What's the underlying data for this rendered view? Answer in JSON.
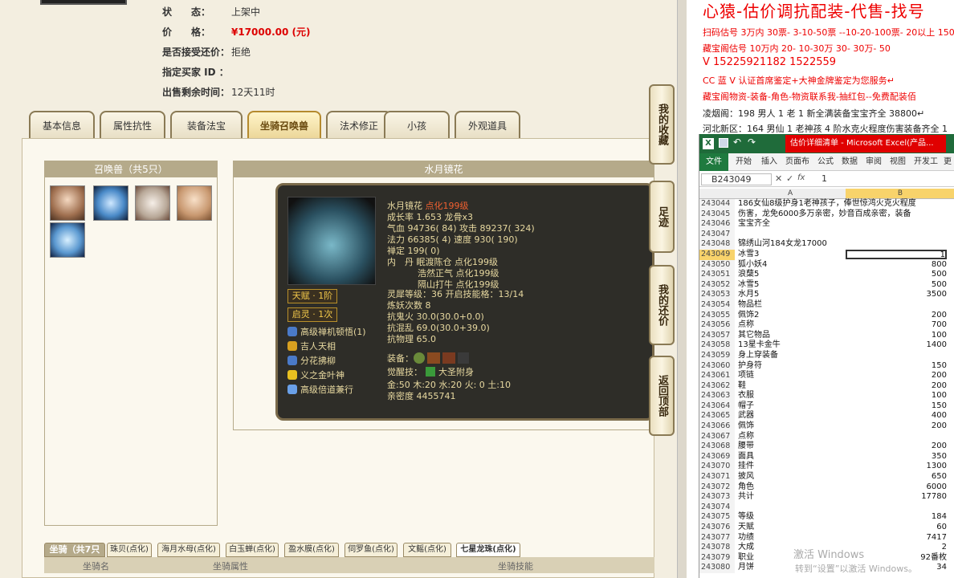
{
  "listing": {
    "status_label": "状　　态：",
    "status_value": "上架中",
    "price_label": "价　　格：",
    "price_value": "¥17000.00 (元)",
    "counter_label": "是否接受还价：",
    "counter_value": "拒绝",
    "buyer_label": "指定买家 ID ：",
    "buyer_value": "",
    "time_label": "出售剩余时间：",
    "time_value": "12天11时"
  },
  "tabs": [
    "基本信息",
    "属性抗性",
    "装备法宝",
    "坐骑召唤兽",
    "法术修正",
    "小孩",
    "外观道具"
  ],
  "active_tab": 3,
  "summon": {
    "header": "召唤兽（共5只）",
    "pets": [
      "pet-1",
      "pet-2",
      "pet-3",
      "pet-4",
      "pet-5"
    ]
  },
  "detail": {
    "header": "水月镜花",
    "name": "水月镜花",
    "name_tag": "点化199级",
    "growth": "成长率 1.653 龙骨x3",
    "hp": "气血 94736( 84) 攻击 89237( 324)",
    "mp": "法力 66385( 4) 速度 930( 190)",
    "zen": "禅定 199( 0)",
    "neidan_1": "内　丹 眠渡陈仓 点化199级",
    "neidan_2": "浩然正气 点化199级",
    "neidan_3": "隔山打牛 点化199级",
    "spirit": "灵犀等级：36 开启技能格：13/14",
    "refine": "炼妖次数 8",
    "resist_1": "抗鬼火 30.0(30.0+0.0)",
    "resist_2": "抗混乱 69.0(30.0+39.0)",
    "resist_3": "抗物理 65.0",
    "equip_label": "装备：",
    "awaken_label": "觉醒技：",
    "awaken_value": "大圣附身",
    "elements": "金:50 木:20 水:20 火: 0 土:10",
    "intimacy": "亲密度 4455741",
    "badge_1": "天赋 · 1阶",
    "badge_2": "启灵 · 1次",
    "skills": [
      "高级禅机顿悟(1)",
      "吉人天相",
      "分花拂柳",
      "义之金叶神",
      "高级倍道兼行"
    ]
  },
  "side_buttons": [
    "我的收藏",
    "足迹",
    "我的还价",
    "返回顶部"
  ],
  "mount": {
    "label": "坐骑（共7只",
    "tabs": [
      "珠贝(点化)",
      "海月水母(点化)",
      "白玉蝉(点化)",
      "盈水膜(点化)",
      "伺罗鱼(点化)",
      "文鳐(点化)",
      "七星龙珠(点化)"
    ],
    "headers": [
      "坐骑名",
      "坐骑属性",
      "坐骑技能"
    ]
  },
  "ads": {
    "title": "心猿-估价调抗配装-代售-找号",
    "line1": "扫码估号 3万内 30票- 3-10-50票 --10-20-100票- 20以上 150+",
    "line2": "藏宝阁估号 10万内 20- 10-30万 30- 30万- 50",
    "phone": "V 15225921182  1522559",
    "line3": "CC 蓝 V 认证首席鉴定+大神金牌鉴定为您服务↵",
    "line4": "藏宝阁物资-装备-角色-物资联系我-抽红包--免费配装佰",
    "line5": "凌烟阁：198 男人 1 老 1 新全满装备宝宝齐全 38800↵",
    "line6": "河北新区：164 男仙 1 老神孩 4 阶水克火程度伤害装备齐全 1"
  },
  "excel": {
    "title": "估价详细清单 - Microsoft Excel(产品...",
    "ribbon": [
      "文件",
      "开始",
      "插入",
      "页面布",
      "公式",
      "数据",
      "审阅",
      "视图",
      "开发工",
      "更"
    ],
    "cell_ref": "B243049",
    "formula": "1",
    "col_a": "A",
    "col_b": "B",
    "rows": [
      {
        "n": "243044",
        "a": "186女仙8级护身1老神孩子，俸世惊鸿火克火程度",
        "b": ""
      },
      {
        "n": "243045",
        "a": "伤害，龙免6000多万亲密，妙音百成亲密，装备",
        "b": ""
      },
      {
        "n": "243046",
        "a": "宝宝齐全",
        "b": ""
      },
      {
        "n": "243047",
        "a": "",
        "b": ""
      },
      {
        "n": "243048",
        "a": "锦绣山河184女龙17000",
        "b": ""
      },
      {
        "n": "243049",
        "a": "冰雪3",
        "b": "1"
      },
      {
        "n": "243050",
        "a": "狐小妖4",
        "b": "800"
      },
      {
        "n": "243051",
        "a": "浪蘖5",
        "b": "500"
      },
      {
        "n": "243052",
        "a": "冰雪5",
        "b": "500"
      },
      {
        "n": "243053",
        "a": "水月5",
        "b": "3500"
      },
      {
        "n": "243054",
        "a": "物品栏",
        "b": ""
      },
      {
        "n": "243055",
        "a": "佩饰2",
        "b": "200"
      },
      {
        "n": "243056",
        "a": "点称",
        "b": "700"
      },
      {
        "n": "243057",
        "a": "其它物品",
        "b": "100"
      },
      {
        "n": "243058",
        "a": "13星卡金牛",
        "b": "1400"
      },
      {
        "n": "243059",
        "a": "身上穿装备",
        "b": ""
      },
      {
        "n": "243060",
        "a": "护身符",
        "b": "150"
      },
      {
        "n": "243061",
        "a": "项链",
        "b": "200"
      },
      {
        "n": "243062",
        "a": "鞋",
        "b": "200"
      },
      {
        "n": "243063",
        "a": "衣服",
        "b": "100"
      },
      {
        "n": "243064",
        "a": "帽子",
        "b": "150"
      },
      {
        "n": "243065",
        "a": "武器",
        "b": "400"
      },
      {
        "n": "243066",
        "a": "佩饰",
        "b": "200"
      },
      {
        "n": "243067",
        "a": "点称",
        "b": ""
      },
      {
        "n": "243068",
        "a": "腰带",
        "b": "200"
      },
      {
        "n": "243069",
        "a": "面具",
        "b": "350"
      },
      {
        "n": "243070",
        "a": "挂件",
        "b": "1300"
      },
      {
        "n": "243071",
        "a": "披风",
        "b": "650"
      },
      {
        "n": "243072",
        "a": "角色",
        "b": "6000"
      },
      {
        "n": "243073",
        "a": "共计",
        "b": "17780"
      },
      {
        "n": "243074",
        "a": "",
        "b": ""
      },
      {
        "n": "243075",
        "a": "等级",
        "b": "184"
      },
      {
        "n": "243076",
        "a": "天赋",
        "b": "60"
      },
      {
        "n": "243077",
        "a": "功绩",
        "b": "7417"
      },
      {
        "n": "243078",
        "a": "大成",
        "b": "2"
      },
      {
        "n": "243079",
        "a": "职业",
        "b": "92番枚"
      },
      {
        "n": "243080",
        "a": "月饼",
        "b": "34"
      }
    ]
  },
  "watermark": {
    "line1": "激活 Windows",
    "line2": "转到“设置”以激活 Windows。"
  }
}
